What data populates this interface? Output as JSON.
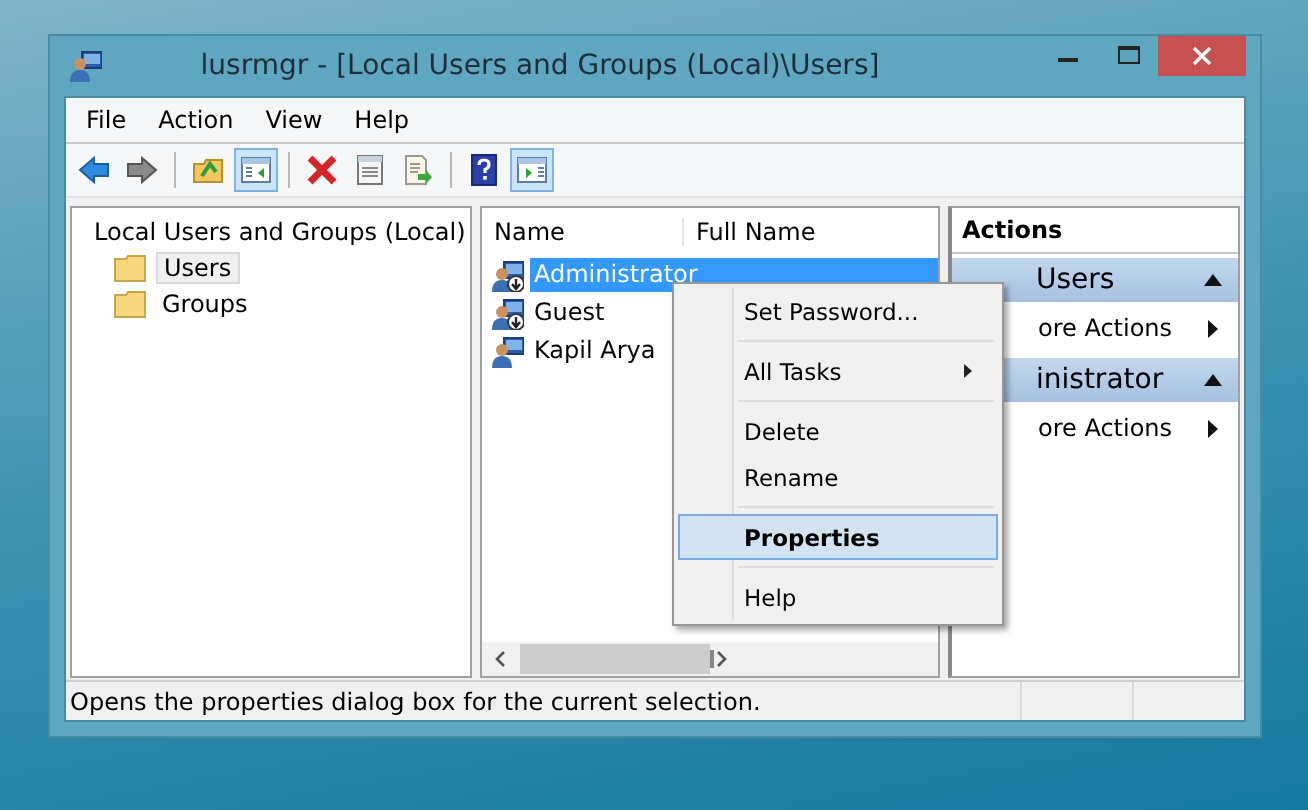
{
  "window": {
    "title": "lusrmgr - [Local Users and Groups (Local)\\Users]"
  },
  "menu_bar": [
    "File",
    "Action",
    "View",
    "Help"
  ],
  "toolbar": [
    {
      "kind": "back",
      "pressed": false
    },
    {
      "kind": "forward",
      "pressed": false
    },
    {
      "kind": "separator"
    },
    {
      "kind": "up",
      "pressed": false
    },
    {
      "kind": "tree",
      "pressed": true
    },
    {
      "kind": "separator"
    },
    {
      "kind": "delete",
      "pressed": false
    },
    {
      "kind": "properties",
      "pressed": false
    },
    {
      "kind": "export",
      "pressed": false
    },
    {
      "kind": "separator"
    },
    {
      "kind": "help",
      "pressed": false
    },
    {
      "kind": "actionpane",
      "pressed": true
    }
  ],
  "tree": {
    "label": "Local Users and Groups (Local)",
    "children": [
      {
        "label": "Users",
        "selected": true
      },
      {
        "label": "Groups",
        "selected": false
      }
    ]
  },
  "list": {
    "columns": [
      "Name",
      "Full Name"
    ],
    "rows": [
      {
        "name": "Administrator",
        "selected": true,
        "disabled": true
      },
      {
        "name": "Guest",
        "selected": false,
        "disabled": true
      },
      {
        "name": "Kapil Arya",
        "selected": false,
        "disabled": false
      }
    ]
  },
  "actions": {
    "title": "Actions",
    "sections": [
      {
        "header": "Users",
        "items": [
          "ore Actions"
        ]
      },
      {
        "header": "inistrator",
        "items": [
          "ore Actions"
        ]
      }
    ]
  },
  "context_menu": [
    {
      "kind": "item",
      "label": "Set Password...",
      "selected": false
    },
    {
      "kind": "separator"
    },
    {
      "kind": "submenu",
      "label": "All Tasks",
      "selected": false
    },
    {
      "kind": "separator"
    },
    {
      "kind": "item",
      "label": "Delete",
      "selected": false
    },
    {
      "kind": "item",
      "label": "Rename",
      "selected": false
    },
    {
      "kind": "separator"
    },
    {
      "kind": "item",
      "label": "Properties",
      "selected": true,
      "bold": true
    },
    {
      "kind": "separator"
    },
    {
      "kind": "item",
      "label": "Help",
      "selected": false
    }
  ],
  "status_bar": "Opens the properties dialog box for the current selection."
}
